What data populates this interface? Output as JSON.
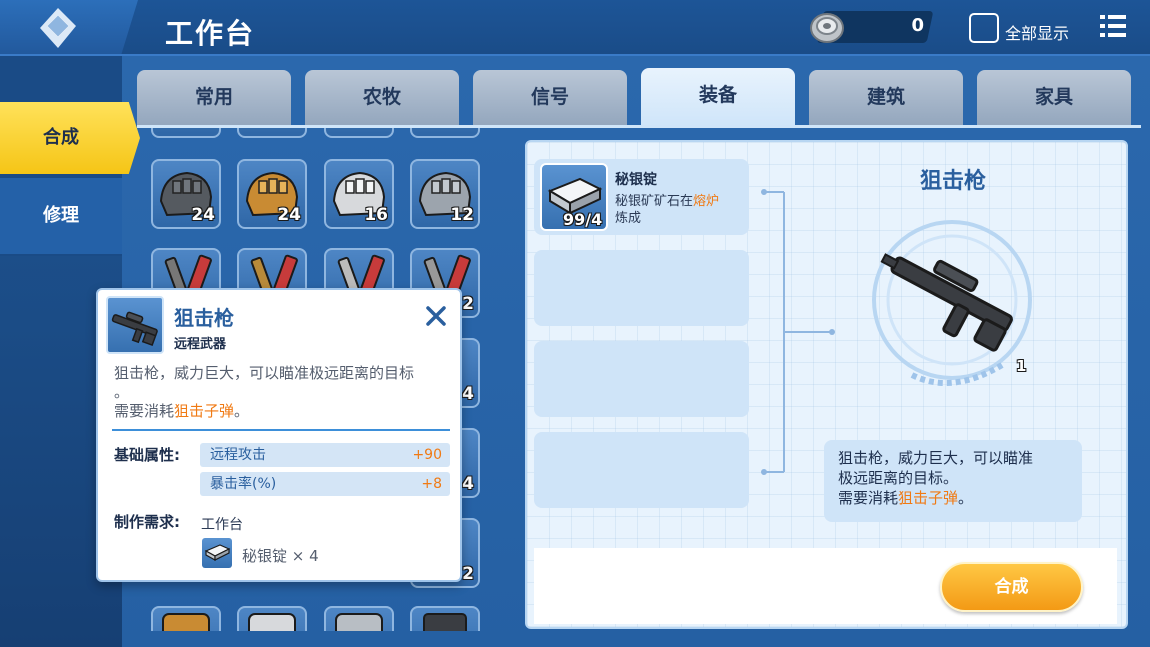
{
  "header": {
    "title": "工作台",
    "coin_count": "0",
    "show_all_label": "全部显示"
  },
  "side_nav": {
    "items": [
      {
        "label": "合成",
        "active": true
      },
      {
        "label": "修理",
        "active": false
      }
    ]
  },
  "tabs": [
    {
      "label": "常用",
      "active": false
    },
    {
      "label": "农牧",
      "active": false
    },
    {
      "label": "信号",
      "active": false
    },
    {
      "label": "装备",
      "active": true
    },
    {
      "label": "建筑",
      "active": false
    },
    {
      "label": "家具",
      "active": false
    }
  ],
  "grid": {
    "row1": [
      {
        "icon": "dark-gauntlet-icon",
        "count": "24",
        "color": "#5e5e5e"
      },
      {
        "icon": "gold-gauntlet-icon",
        "count": "24",
        "color": "#c98b33"
      },
      {
        "icon": "silver-gauntlet-icon",
        "count": "16",
        "color": "#d7d7d7"
      },
      {
        "icon": "steel-gauntlet-icon",
        "count": "12",
        "color": "#9ca4ad"
      }
    ],
    "row2_partial_counts": [
      "2"
    ],
    "row3_partial_counts": [
      "4"
    ],
    "row4_partial_counts": [
      "4"
    ],
    "row5_partial_counts": [
      "2"
    ]
  },
  "recipe": {
    "material": {
      "name": "秘银锭",
      "count": "99/4",
      "desc_prefix": "秘银矿矿石在",
      "desc_highlight": "熔炉",
      "desc_suffix": "炼成"
    },
    "result": {
      "name": "狙击枪",
      "count": "1",
      "desc_line1": "狙击枪，威力巨大，可以瞄准",
      "desc_line2": "极远距离的目标。",
      "desc_prefix": "需要消耗",
      "desc_highlight": "狙击子弹",
      "desc_suffix": "。"
    },
    "craft_button": "合成"
  },
  "tooltip": {
    "name": "狙击枪",
    "type": "远程武器",
    "desc_line1": "狙击枪，威力巨大，可以瞄准极远距离的目标",
    "desc_line2": "。",
    "desc_prefix": "需要消耗",
    "desc_highlight": "狙击子弹",
    "desc_suffix": "。",
    "base_attr_label": "基础属性:",
    "stats": [
      {
        "name": "远程攻击",
        "value": "+90"
      },
      {
        "name": "暴击率(%)",
        "value": "+8"
      }
    ],
    "craft_req_label": "制作需求:",
    "bench": "工作台",
    "material_text": "秘银锭 × 4"
  },
  "colors": {
    "accent_yellow": "#f5c516",
    "highlight_orange": "#f07a14",
    "title_blue": "#2a5f9e"
  }
}
